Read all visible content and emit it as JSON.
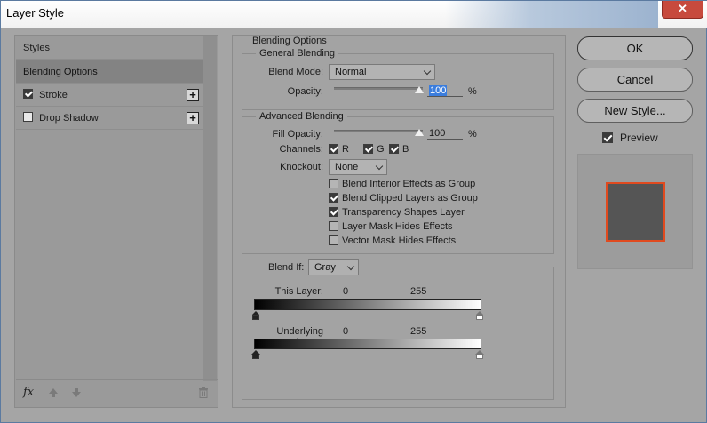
{
  "window": {
    "title": "Layer Style",
    "close_glyph": "✕"
  },
  "left_panel": {
    "items": [
      {
        "label": "Styles",
        "selected": false
      },
      {
        "label": "Blending Options",
        "selected": true
      },
      {
        "label": "Stroke",
        "checked": true,
        "has_add": true
      },
      {
        "label": "Drop Shadow",
        "checked": false,
        "has_add": true
      }
    ],
    "add_glyph": "+",
    "footer": {
      "fx_label": "fx",
      "icons": [
        "fx-icon",
        "arrow-up-icon",
        "arrow-down-icon",
        "trash-icon"
      ]
    }
  },
  "blending_options": {
    "section_title": "Blending Options",
    "general": {
      "title": "General Blending",
      "blend_mode_label": "Blend Mode:",
      "blend_mode_value": "Normal",
      "opacity_label": "Opacity:",
      "opacity_value": "100",
      "opacity_unit": "%"
    },
    "advanced": {
      "title": "Advanced Blending",
      "fill_opacity_label": "Fill Opacity:",
      "fill_opacity_value": "100",
      "fill_opacity_unit": "%",
      "channels_label": "Channels:",
      "channels": [
        {
          "label": "R",
          "checked": true
        },
        {
          "label": "G",
          "checked": true
        },
        {
          "label": "B",
          "checked": true
        }
      ],
      "knockout_label": "Knockout:",
      "knockout_value": "None",
      "options": [
        {
          "label": "Blend Interior Effects as Group",
          "checked": false
        },
        {
          "label": "Blend Clipped Layers as Group",
          "checked": true
        },
        {
          "label": "Transparency Shapes Layer",
          "checked": true
        },
        {
          "label": "Layer Mask Hides Effects",
          "checked": false
        },
        {
          "label": "Vector Mask Hides Effects",
          "checked": false
        }
      ]
    },
    "blend_if": {
      "label": "Blend If:",
      "value": "Gray",
      "this_layer_label": "This Layer:",
      "this_layer_low": "0",
      "this_layer_high": "255",
      "underlying_label": "Underlying Layer:",
      "underlying_low": "0",
      "underlying_high": "255"
    }
  },
  "buttons": {
    "ok": "OK",
    "cancel": "Cancel",
    "new_style": "New Style..."
  },
  "preview": {
    "label": "Preview",
    "checked": true,
    "swatch_fill": "#555555",
    "swatch_border": "#e04a1f"
  },
  "colors": {
    "dialog_bg": "#a5a5a5",
    "selected_row": "#838383",
    "close_button": "#c74a3d",
    "highlight": "#3b7ddd"
  }
}
